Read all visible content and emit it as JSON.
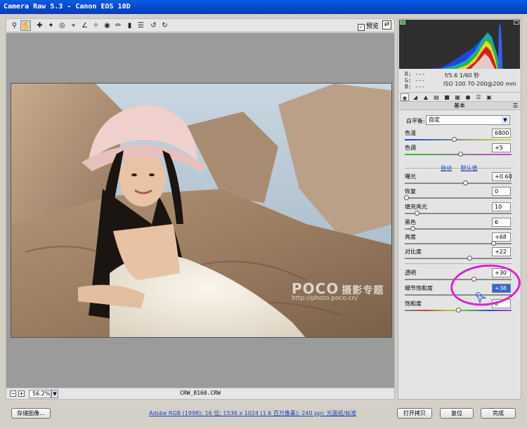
{
  "window": {
    "title": "Camera Raw 5.3 -  Canon EOS 10D"
  },
  "toolbar": {
    "tools": [
      "zoom-icon",
      "hand-icon",
      "white-balance-icon",
      "color-sampler-icon",
      "target-adjust-icon",
      "crop-icon",
      "straighten-icon",
      "spot-removal-icon",
      "red-eye-icon",
      "adjustment-brush-icon",
      "graduated-filter-icon",
      "preferences-icon",
      "rotate-ccw-icon",
      "rotate-cw-icon"
    ],
    "preview_label": "预览"
  },
  "status": {
    "zoom": "56.2%",
    "filename": "CRW_8160.CRW"
  },
  "watermark": {
    "logo": "POCO",
    "tagline": "摄影专题",
    "url": "http://photo.poco.cn/"
  },
  "info": {
    "r": "R:  ---",
    "g": "G:  ---",
    "b": "B:  ---",
    "aperture_shutter": "f/5.6   1/60 秒",
    "iso_lens": "ISO 100   70-200@200 mm"
  },
  "panel": {
    "tab_icons": [
      "basic-tab-icon",
      "tone-curve-tab-icon",
      "detail-tab-icon",
      "hsl-tab-icon",
      "split-toning-tab-icon",
      "lens-corrections-tab-icon",
      "camera-calibration-tab-icon",
      "presets-tab-icon",
      "snapshots-tab-icon"
    ],
    "section_title": "基本",
    "white_balance_label": "白平衡:",
    "white_balance_value": "自定",
    "auto_link": "自动",
    "default_link": "默认值",
    "sliders": [
      {
        "label": "色温",
        "value": "6800",
        "level": 0.46
      },
      {
        "label": "色调",
        "value": "+5",
        "level": 0.52
      },
      {
        "label": "曝光",
        "value": "+0.60",
        "level": 0.57
      },
      {
        "label": "恢复",
        "value": "0",
        "level": 0.0
      },
      {
        "label": "填充亮光",
        "value": "10",
        "level": 0.1
      },
      {
        "label": "黑色",
        "value": "6",
        "level": 0.06
      },
      {
        "label": "亮度",
        "value": "+68",
        "level": 0.84
      },
      {
        "label": "对比度",
        "value": "+22",
        "level": 0.61
      },
      {
        "label": "透明",
        "value": "+30",
        "level": 0.65
      },
      {
        "label": "细节饱和度",
        "value": "+38",
        "level": 0.69
      },
      {
        "label": "饱和度",
        "value": "0",
        "level": 0.5
      }
    ]
  },
  "bottom": {
    "save_label": "存储图像...",
    "workflow_text": "Adobe RGB (1998); 16 位; 1536 x 1024 (1.6 百万像素); 240 ppi; 光面纸/标准",
    "open_label": "打开拷贝",
    "reset_label": "复位",
    "done_label": "完成"
  }
}
